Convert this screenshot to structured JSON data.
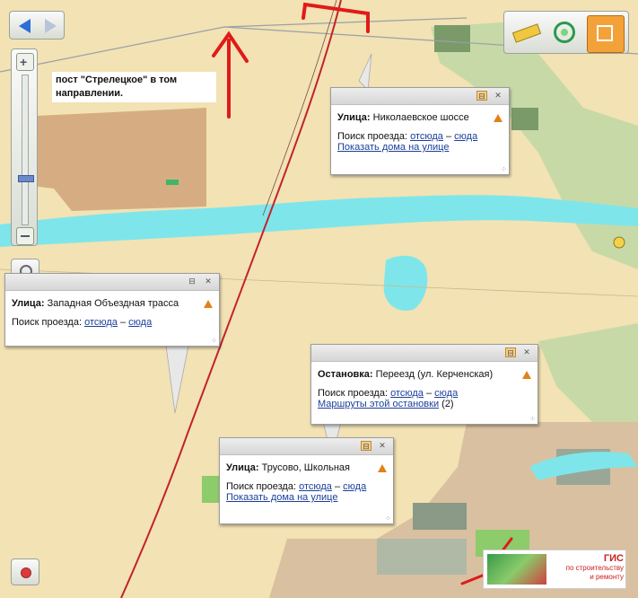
{
  "annotation": {
    "text": "пост \"Стрелецкое\" в том направлении."
  },
  "popups": {
    "nikolaevskoe": {
      "type_label": "Улица:",
      "name": "Николаевское шоссе",
      "search_label": "Поиск проезда:",
      "from_link": "отсюда",
      "dash": "–",
      "to_link": "сюда",
      "extra_link": "Показать дома на улице"
    },
    "zapadnaya": {
      "type_label": "Улица:",
      "name": "Западная Объездная трасса",
      "search_label": "Поиск проезда:",
      "from_link": "отсюда",
      "dash": "–",
      "to_link": "сюда"
    },
    "pereezd": {
      "type_label": "Остановка:",
      "name": "Переезд (ул. Керченская)",
      "search_label": "Поиск проезда:",
      "from_link": "отсюда",
      "dash": "–",
      "to_link": "сюда",
      "extra_link": "Маршруты этой остановки",
      "extra_count": "(2)"
    },
    "trusovo": {
      "type_label": "Улица:",
      "name": "Трусово, Школьная",
      "search_label": "Поиск проезда:",
      "from_link": "отсюда",
      "dash": "–",
      "to_link": "сюда",
      "extra_link": "Показать дома на улице"
    }
  },
  "logo": {
    "line1": "ГИС",
    "line2": "по строительству",
    "line3": "и ремонту"
  },
  "icons": {
    "back": "arrow-left-icon",
    "forward": "arrow-right-icon",
    "zoom_in": "plus-icon",
    "zoom_out": "minus-icon",
    "select": "magnifier-icon",
    "ruler": "ruler-icon",
    "radar": "radar-icon",
    "box3d": "cube-icon",
    "locate": "locate-icon"
  },
  "colors": {
    "land": "#f2e2b4",
    "water": "#7ee6ea",
    "river_road": "#c2232a",
    "annotation_red": "#e01a1a",
    "link": "#1b3f9a",
    "warn": "#e0821a"
  }
}
